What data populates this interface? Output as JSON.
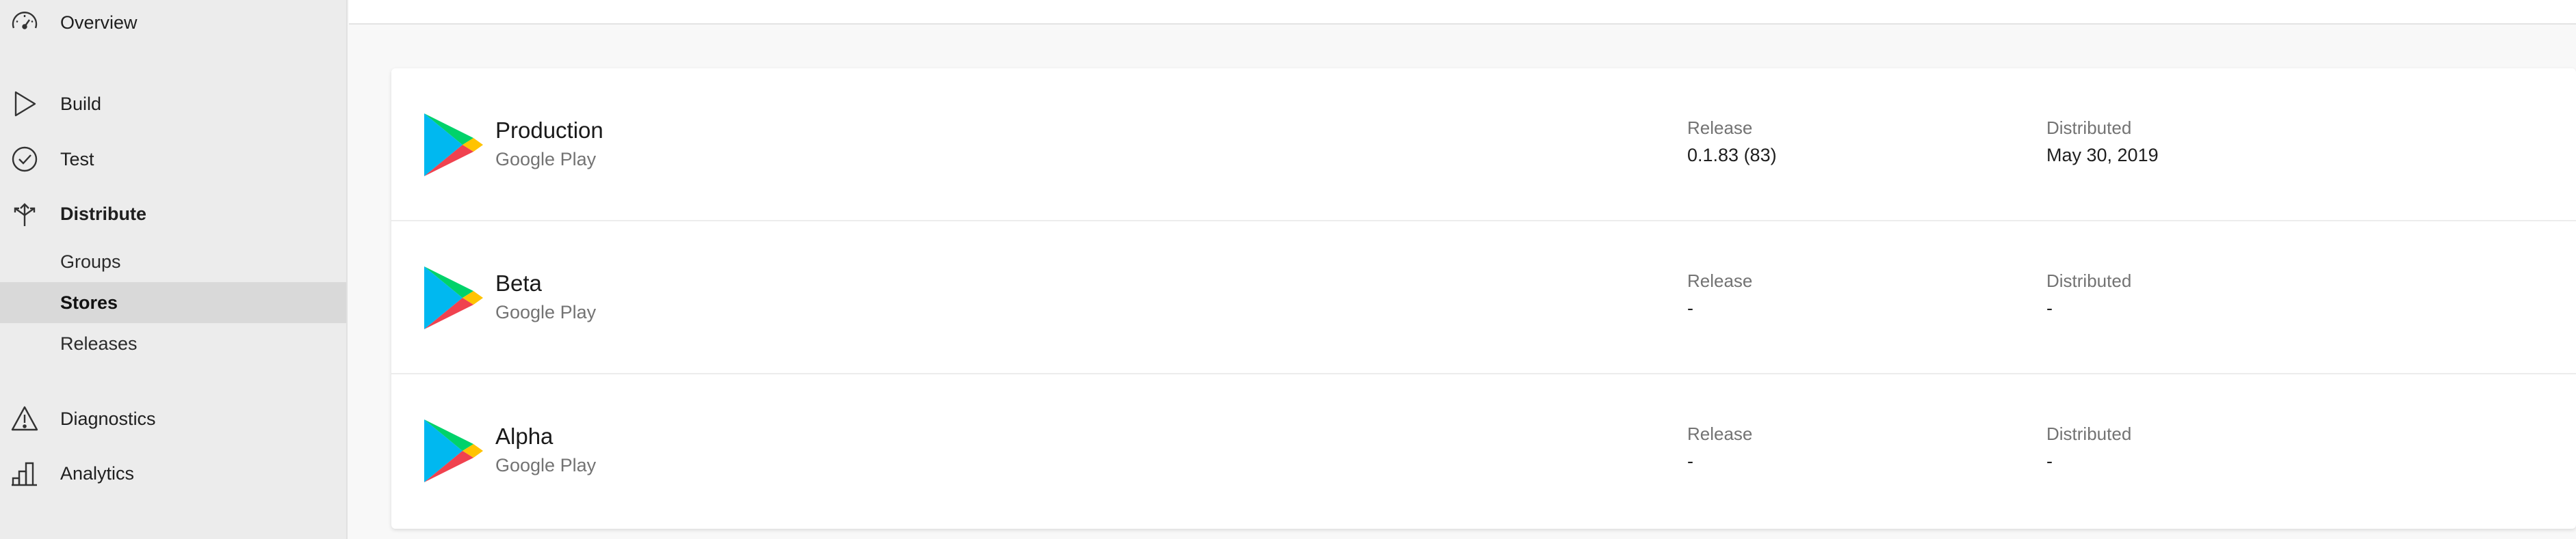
{
  "sidebar": {
    "items": [
      {
        "label": "Overview",
        "icon": "gauge-icon"
      },
      {
        "label": "Build",
        "icon": "play-outline-icon"
      },
      {
        "label": "Test",
        "icon": "check-circle-icon"
      },
      {
        "label": "Distribute",
        "icon": "distribute-arrows-icon",
        "active": true
      },
      {
        "label": "Diagnostics",
        "icon": "warning-triangle-icon"
      },
      {
        "label": "Analytics",
        "icon": "bar-chart-icon"
      }
    ],
    "distribute_sub": [
      {
        "label": "Groups"
      },
      {
        "label": "Stores",
        "selected": true
      },
      {
        "label": "Releases"
      }
    ]
  },
  "stores": {
    "release_label": "Release",
    "distributed_label": "Distributed",
    "rows": [
      {
        "name": "Production",
        "provider": "Google Play",
        "release": "0.1.83 (83)",
        "distributed": "May 30, 2019",
        "icon": "google-play-icon"
      },
      {
        "name": "Beta",
        "provider": "Google Play",
        "release": "-",
        "distributed": "-",
        "icon": "google-play-icon"
      },
      {
        "name": "Alpha",
        "provider": "Google Play",
        "release": "-",
        "distributed": "-",
        "icon": "google-play-icon"
      }
    ]
  },
  "colors": {
    "sidebar_bg": "#ececec",
    "selected_bg": "#d9d9d9",
    "play_green": "#00d26a",
    "play_blue": "#00b8f0",
    "play_yellow": "#ffc300",
    "play_red": "#f0424f"
  }
}
